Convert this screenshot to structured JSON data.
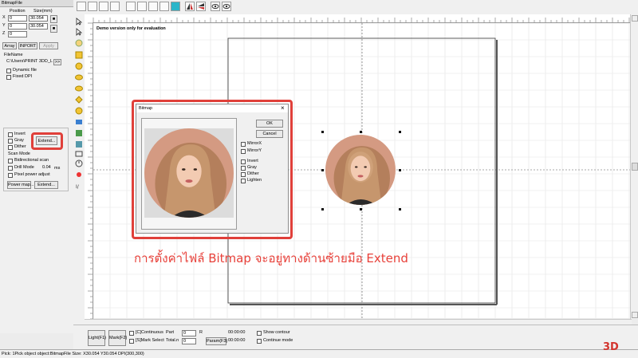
{
  "panel": {
    "title": "BitmapFile",
    "position_header": "Position",
    "size_header": "Size(mm)",
    "x_label": "X",
    "y_label": "Y",
    "z_label": "Z",
    "x_value": "0",
    "y_value": "0",
    "z_value": "0",
    "size_w": "30.054",
    "size_h": "30.054",
    "array_btn": "Array",
    "import_btn": "INPORT",
    "apply_btn": "Apply",
    "filename_label": "FileName",
    "filename_value": "C:\\Users\\PRINT 3DD_LA(",
    "browse_btn": ">>",
    "dynamic_file": "Dynamic file",
    "fixed_dpi": "Fixed DPI",
    "invert": "Invert",
    "gray": "Gray",
    "dither": "Dither",
    "extend_btn": "Extend...",
    "scan_mode": "Scan Mode",
    "bidirectional": "Bidirectional scan",
    "drill_mode": "Drill Mode",
    "drill_value": "0.04",
    "drill_unit": "ms",
    "pixel_power": "Pixel power adjust",
    "power_map_btn": "Power map...",
    "extend2_btn": "Extend..."
  },
  "canvas": {
    "demo_text": "Demo version only for evaluation"
  },
  "dialog": {
    "title": "Bitmap",
    "close": "×",
    "ok": "OK",
    "cancel": "Cancel",
    "mirror_x": "MirrorX",
    "mirror_y": "MirrorY",
    "invert": "Invert",
    "gray": "Gray",
    "dither": "Dither",
    "lighten": "Lighten"
  },
  "bottom": {
    "light_btn": "Light(F1)",
    "mark_btn": "Mark(F2)",
    "continuous": "[C]Continuous",
    "mark_select": "[S]Mark Select",
    "part_label": "Part",
    "part_value": "0",
    "r_label": "R",
    "total_label": "Total.n",
    "total_value": "0",
    "time1": "00:00:00",
    "time2": "00:00:00",
    "param_btn": "Param(F3)",
    "show_contour": "Show contour",
    "continue_mode": "Continue mode"
  },
  "status": "Pick: 1Pick object object:BitmapFile Size: X30.054 Y30.054 DPI(300,300)",
  "caption": "การตั้งค่าไฟล์ Bitmap จะอยู่ทางด้านซ้ายมือ Extend",
  "logo": "3D"
}
